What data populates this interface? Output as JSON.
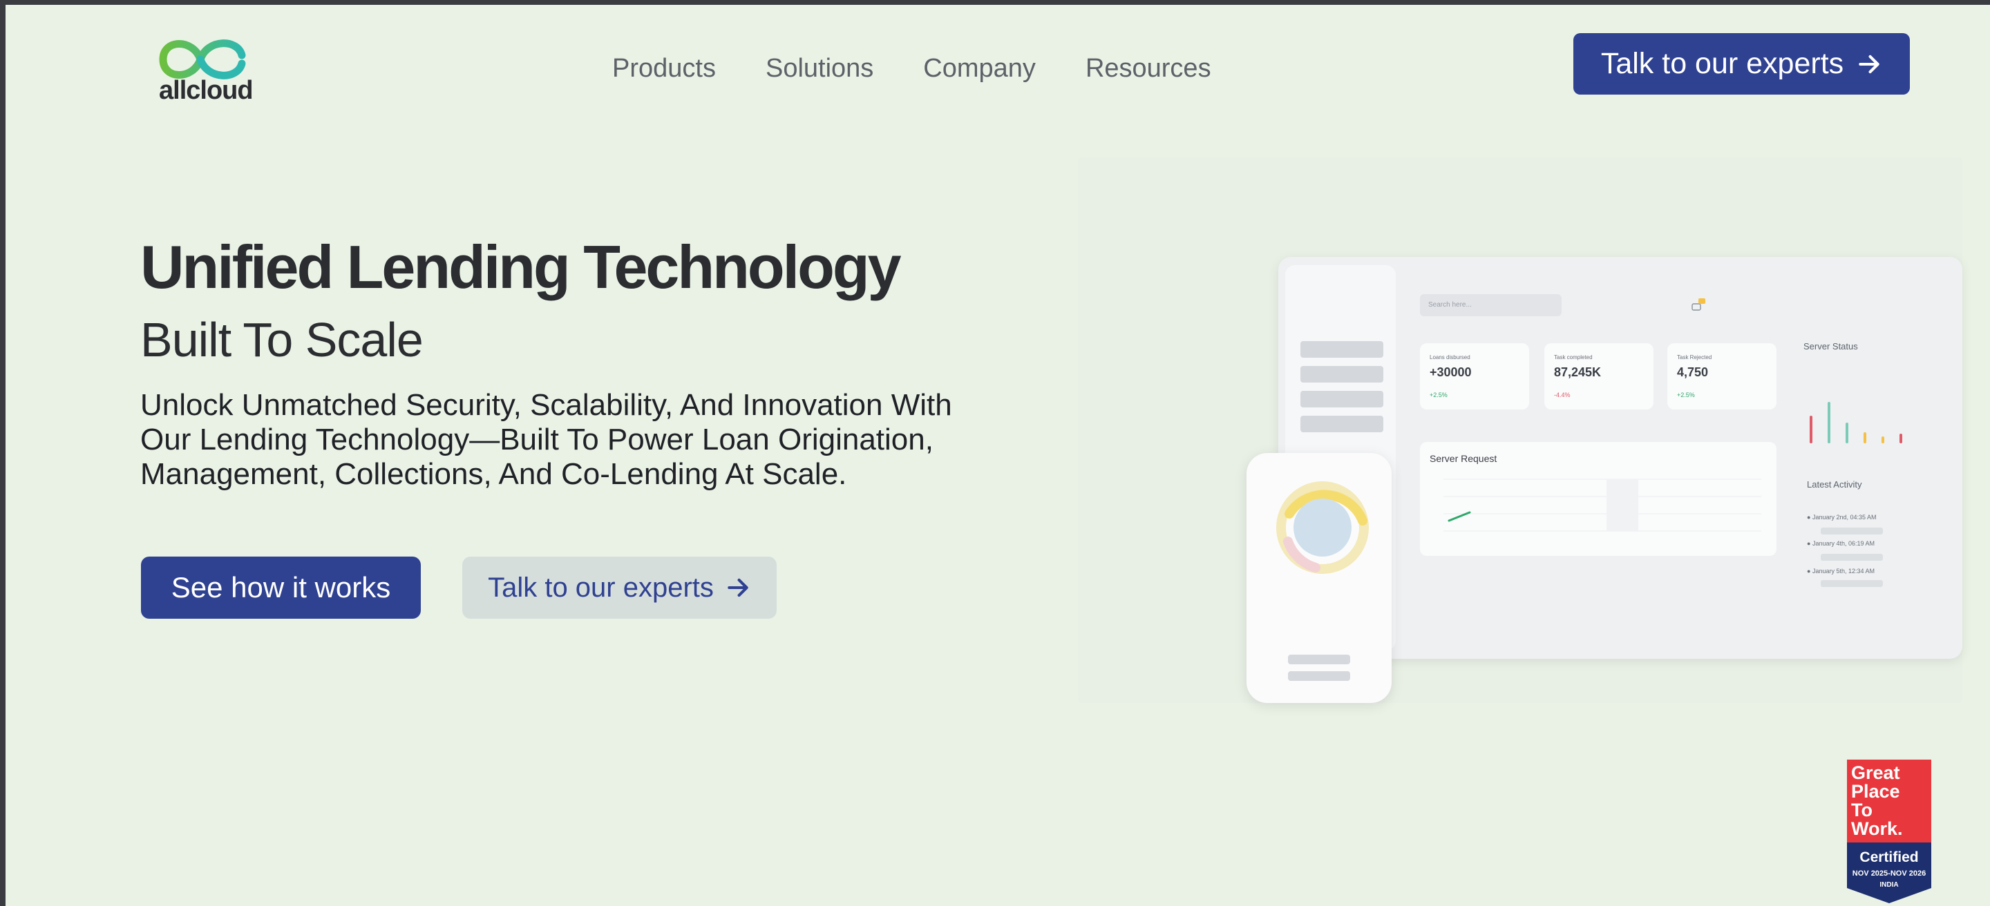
{
  "brand": {
    "name": "allcloud",
    "colors": {
      "green": "#6cbf3f",
      "teal": "#2fb8b0",
      "primary": "#2f4191"
    }
  },
  "nav": {
    "items": [
      "Products",
      "Solutions",
      "Company",
      "Resources"
    ]
  },
  "header": {
    "cta_label": "Talk to our experts"
  },
  "hero": {
    "title": "Unified Lending Technology",
    "subtitle": "Built To Scale",
    "description": "Unlock Unmatched Security, Scalability, And Innovation With Our Lending Technology—Built To Power Loan Origination, Management, Collections, And Co-Lending At Scale.",
    "primary_button": "See how it works",
    "secondary_button": "Talk to our experts"
  },
  "dashboard": {
    "search_placeholder": "Search here...",
    "stats": [
      {
        "label": "Loans disbursed",
        "value": "+30000",
        "change": "+2.5%",
        "change_color": "#2fa86b"
      },
      {
        "label": "Task completed",
        "value": "87,245K",
        "change": "-4.4%",
        "change_color": "#e05a68"
      },
      {
        "label": "Task Rejected",
        "value": "4,750",
        "change": "+2.5%",
        "change_color": "#2fa86b"
      }
    ],
    "server_request_title": "Server Request",
    "server_status_title": "Server Status",
    "latest_activity_title": "Latest Activity",
    "activity": [
      "January 2nd, 04:35 AM",
      "January 4th, 06:19 AM",
      "January 5th, 12:34 AM"
    ]
  },
  "badge": {
    "line1": "Great",
    "line2": "Place",
    "line3": "To",
    "line4": "Work.",
    "certified": "Certified",
    "dates": "NOV 2025-NOV 2026",
    "country": "INDIA"
  }
}
